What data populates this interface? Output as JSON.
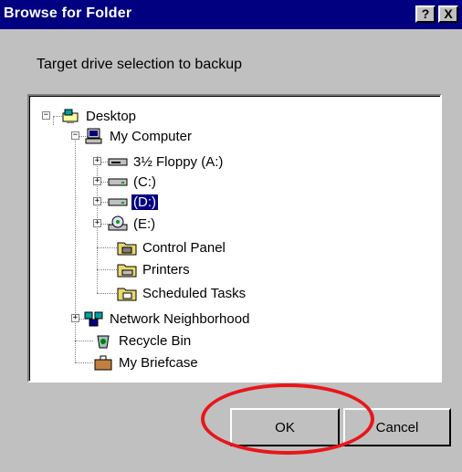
{
  "dialog": {
    "title": "Browse for Folder",
    "help_btn": "?",
    "close_btn": "X",
    "prompt": "Target drive selection to backup",
    "ok_label": "OK",
    "cancel_label": "Cancel"
  },
  "tree": [
    {
      "label": "Desktop",
      "icon": "desktop-icon"
    },
    {
      "label": "My Computer",
      "icon": "computer-icon"
    },
    {
      "label": "3½ Floppy (A:)",
      "icon": "floppy-drive-icon"
    },
    {
      "label": "(C:)",
      "icon": "hard-drive-icon"
    },
    {
      "label": "(D:)",
      "icon": "hard-drive-icon",
      "selected": true
    },
    {
      "label": "(E:)",
      "icon": "cd-drive-icon"
    },
    {
      "label": "Control Panel",
      "icon": "control-panel-icon"
    },
    {
      "label": "Printers",
      "icon": "printers-icon"
    },
    {
      "label": "Scheduled Tasks",
      "icon": "scheduled-tasks-icon"
    },
    {
      "label": "Network Neighborhood",
      "icon": "network-icon"
    },
    {
      "label": "Recycle Bin",
      "icon": "recycle-bin-icon"
    },
    {
      "label": "My Briefcase",
      "icon": "briefcase-icon"
    }
  ],
  "colors": {
    "titlebar": "#000080",
    "selection": "#000080",
    "highlight_oval": "#e8161a"
  }
}
